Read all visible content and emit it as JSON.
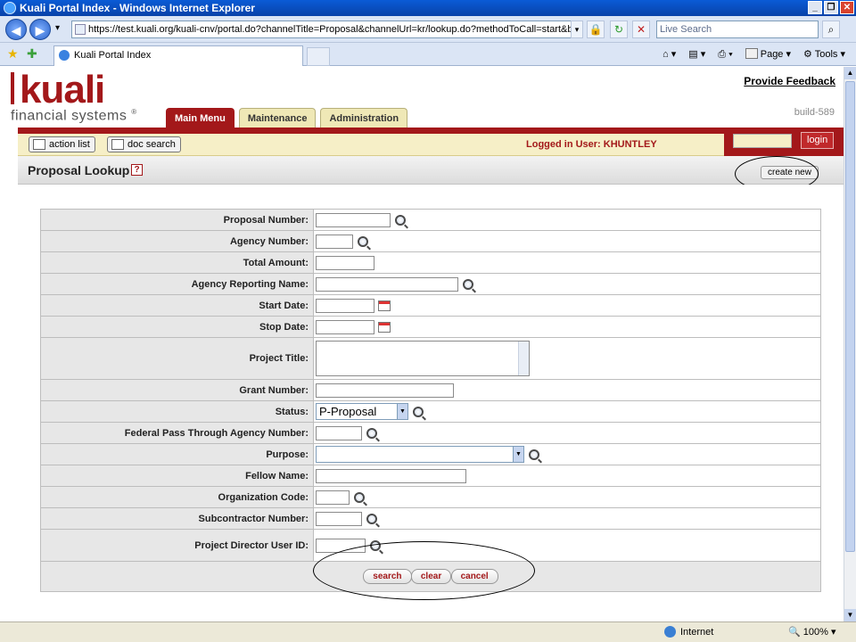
{
  "window": {
    "title": "Kuali Portal Index - Windows Internet Explorer",
    "min": "_",
    "max": "❐",
    "close": "✕"
  },
  "browser": {
    "back": "◀",
    "forward": "▶",
    "dropdown": "▾",
    "address": "https://test.kuali.org/kuali-cnv/portal.do?channelTitle=Proposal&channelUrl=kr/lookup.do?methodToCall=start&businessO",
    "search_placeholder": "Live Search",
    "tab_title": "Kuali Portal Index",
    "commands": {
      "page": "Page",
      "tools": "Tools"
    },
    "status_zone": "Internet",
    "zoom": "100%"
  },
  "header": {
    "logo_main": "kuali",
    "logo_sub": "financial systems",
    "logo_mark": "®",
    "feedback": "Provide Feedback",
    "build": "build-589",
    "tabs": [
      {
        "label": "Main Menu"
      },
      {
        "label": "Maintenance"
      },
      {
        "label": "Administration"
      }
    ],
    "action_list": "action list",
    "doc_search": "doc search",
    "logged_in": "Logged in User: KHUNTLEY",
    "login": "login"
  },
  "lookup": {
    "title": "Proposal Lookup",
    "help": "?",
    "create_new": "create new",
    "fields": [
      {
        "label": "Proposal Number:"
      },
      {
        "label": "Agency Number:"
      },
      {
        "label": "Total Amount:"
      },
      {
        "label": "Agency Reporting Name:"
      },
      {
        "label": "Start Date:"
      },
      {
        "label": "Stop Date:"
      },
      {
        "label": "Project Title:"
      },
      {
        "label": "Grant Number:"
      },
      {
        "label": "Status:",
        "value": "P-Proposal"
      },
      {
        "label": "Federal Pass Through Agency Number:"
      },
      {
        "label": "Purpose:",
        "value": ""
      },
      {
        "label": "Fellow Name:"
      },
      {
        "label": "Organization Code:"
      },
      {
        "label": "Subcontractor Number:"
      },
      {
        "label": "Project Director User ID:"
      }
    ],
    "buttons": {
      "search": "search",
      "clear": "clear",
      "cancel": "cancel"
    }
  },
  "colors": {
    "brand": "#a3181a",
    "tab_bg": "#efe8b6",
    "user_bar": "#f6efc7",
    "label_bg": "#e7e7e7"
  }
}
